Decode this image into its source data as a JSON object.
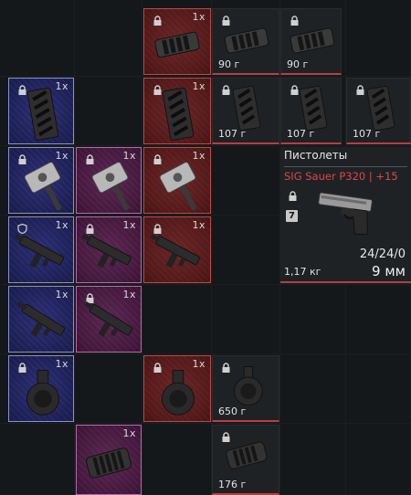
{
  "items": {
    "blue_handguard_row2": {
      "qty": "1x"
    },
    "blue_hammer_row3": {
      "qty": "1x"
    },
    "blue_smg_row4": {
      "qty": "1x"
    },
    "blue_smg_row5": {
      "qty": "1x"
    },
    "blue_drum_mag_row6": {
      "qty": "1x"
    },
    "purple_hammer_row3": {
      "qty": "1x"
    },
    "purple_smg_row4": {
      "qty": "1x"
    },
    "purple_smg_row5": {
      "qty": "1x"
    },
    "purple_muzzle_row7": {
      "qty": "1x"
    },
    "red_muzzle_row1": {
      "qty": "1x"
    },
    "red_handguard_row2": {
      "qty": "1x"
    },
    "red_hammer_row3": {
      "qty": "1x"
    },
    "red_smg_row4": {
      "qty": "1x"
    },
    "red_drum_mag_row6": {
      "qty": "1x"
    },
    "muzzle_90_a": {
      "weight": "90 г"
    },
    "muzzle_90_b": {
      "weight": "90 г"
    },
    "handguard_107_a": {
      "weight": "107 г"
    },
    "handguard_107_b": {
      "weight": "107 г"
    },
    "handguard_107_c": {
      "weight": "107 г"
    },
    "drum_mag_650": {
      "weight": "650 г"
    },
    "muzzle_176": {
      "weight": "176 г"
    }
  },
  "pistol_panel": {
    "category": "Пистолеты",
    "name": "SIG Sauer P320 | +15",
    "badge": "7",
    "ammo": "24/24/0",
    "weight": "1,17 кг",
    "caliber": "9 мм"
  },
  "colors": {
    "blue_bg": "#1e2158",
    "purple_bg": "#46193f",
    "red_bg": "#551a1a",
    "accent_red": "#d94848"
  }
}
